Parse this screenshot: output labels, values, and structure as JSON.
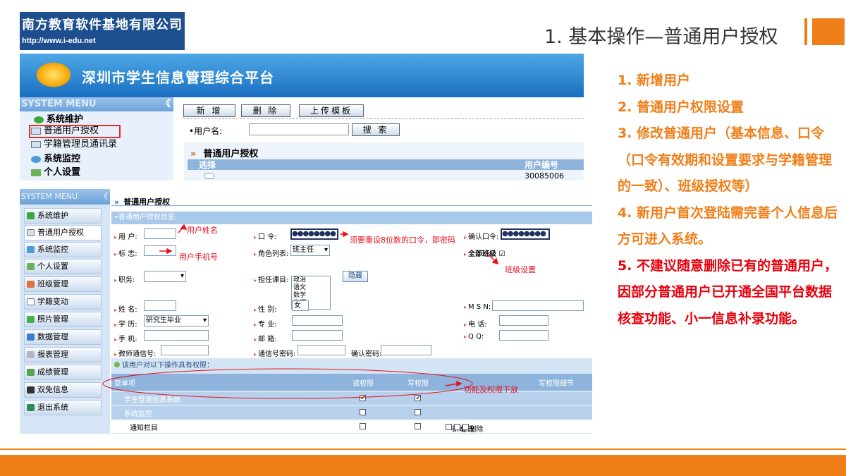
{
  "company": {
    "name": "南方教育软件基地有限公司",
    "url": "http://www.i-edu.net"
  },
  "slide": {
    "title": "1. 基本操作—普通用户授权"
  },
  "bullets": [
    {
      "text": "1. 新增用户",
      "color": "orange"
    },
    {
      "text": "2. 普通用户权限设置",
      "color": "orange"
    },
    {
      "text": "3. 修改普通用户（基本信息、口令（口令有效期和设置要求与学籍管理的一致）、班级授权等）",
      "color": "orange"
    },
    {
      "text": "4. 新用户首次登陆需完善个人信息后方可进入系统。",
      "color": "orange"
    },
    {
      "text": "5. 不建议随意删除已有的普通用户，因部分普通用户已开通全国平台数据核查功能、小一信息补录功能。",
      "color": "red"
    }
  ],
  "colors": {
    "accent": "#f07f1a",
    "warn": "#e8000c",
    "brand": "#1d4f8f"
  },
  "screen1": {
    "platform_title": "深圳市学生信息管理综合平台",
    "system_menu": "SYSTEM MENU",
    "collapse": "《",
    "menu": [
      "系统维护",
      "普通用户授权",
      "学籍管理员通讯录",
      "系统监控",
      "个人设置"
    ],
    "buttons": [
      "新 增",
      "删 除",
      "上传模板"
    ],
    "username_label": "•用户名:",
    "search_button": "搜 索",
    "panel_title": "普通用户授权",
    "panel_marker": "»",
    "col_select": "选择",
    "col_userno": "用户编号",
    "row_userno": "30085006"
  },
  "screen2": {
    "system_menu": "SYSTEM MENU",
    "collapse": "《",
    "breadcrumb": "普通用户授权",
    "menu": [
      "系统维护",
      "普通用户授权",
      "系统监控",
      "个人设置",
      "班级管理",
      "学籍变动",
      "照片管理",
      "数据管理",
      "报表管理",
      "成绩管理",
      "双免信息",
      "退出系统"
    ],
    "section": "•普通用户授权信息:",
    "fields": {
      "user": "用 户:",
      "password": "口  令:",
      "confirm": "确认口令:",
      "flag": "标 志:",
      "role_list": "角色列表:",
      "all_classes": "全部班级",
      "duty": "职务:",
      "subjects": "担任课目:",
      "name": "姓 名:",
      "gender": "性    别:",
      "msn": "M S N:",
      "education": "学 历:",
      "major": "专    业:",
      "phone": "电    话:",
      "mobile": "手 机:",
      "email": "邮    箱:",
      "qq": "Q      Q:",
      "teacher_msg": "教师通信号:",
      "msg_pwd": "通信号密码:",
      "confirm_pwd": "确认密码:"
    },
    "values": {
      "password": "●●●●●●●●",
      "confirm": "●●●●●●●●",
      "role": "班主任",
      "gender": "女",
      "education": "研究生毕业",
      "subjects": [
        "政治",
        "语文",
        "数学",
        "物理"
      ],
      "all_classes_checked": "☑"
    },
    "hide_button": "隐藏",
    "annotations": {
      "user_name": "用户姓名",
      "user_phone": "用户手机号",
      "password_hint": "须要重设8位数的口令，即密码",
      "class_setting": "班级设置",
      "perm_hint": "功能及权限下放"
    },
    "perm_header": "该用户对以下操作具有权限：",
    "table": {
      "cols": [
        "菜单项",
        "读权限",
        "写权限",
        "写权限细节"
      ],
      "rows": [
        {
          "name": "学生管理信息系统",
          "read": "✓",
          "write": "✓"
        },
        {
          "name": "系统监控",
          "read": "",
          "write": ""
        },
        {
          "name": "通知栏目",
          "read": "",
          "write": ""
        }
      ],
      "details": [
        "新增",
        "修改",
        "删除"
      ]
    }
  }
}
